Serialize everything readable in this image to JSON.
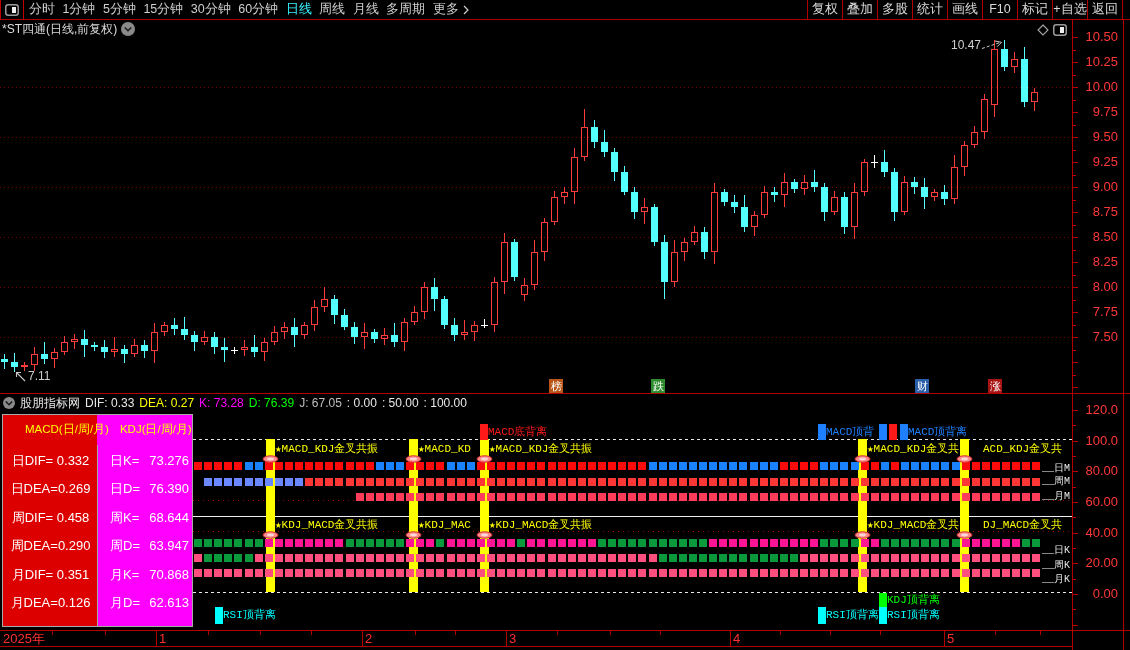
{
  "toolbar": {
    "periods": [
      {
        "label": "分时",
        "selected": false
      },
      {
        "label": "1分钟",
        "selected": false
      },
      {
        "label": "5分钟",
        "selected": false
      },
      {
        "label": "15分钟",
        "selected": false
      },
      {
        "label": "30分钟",
        "selected": false
      },
      {
        "label": "60分钟",
        "selected": false
      },
      {
        "label": "日线",
        "selected": true
      },
      {
        "label": "周线",
        "selected": false
      },
      {
        "label": "月线",
        "selected": false
      },
      {
        "label": "多周期",
        "selected": false
      }
    ],
    "more_menu": {
      "label": "更多"
    },
    "actions": [
      "复权",
      "叠加",
      "多股",
      "统计",
      "画线",
      "F10",
      "标记",
      "+自选",
      "返回"
    ]
  },
  "price_chart": {
    "title": "*ST四通(日线,前复权)",
    "high_label": "10.47",
    "low_label": "7.11",
    "price_ticks": [
      "10.50",
      "10.25",
      "10.00",
      "9.75",
      "9.50",
      "9.25",
      "9.00",
      "8.75",
      "8.50",
      "8.25",
      "8.00",
      "7.75",
      "7.50"
    ],
    "event_tags": [
      {
        "text": "榜",
        "color": "#b8561a"
      },
      {
        "text": "跌",
        "color": "#2e8b2e"
      },
      {
        "text": "财",
        "color": "#2a5ea8"
      },
      {
        "text": "涨",
        "color": "#a81414"
      }
    ]
  },
  "indicator": {
    "name": "股朋指标网",
    "readouts": [
      {
        "text": "DIF: 0.33",
        "color": "#e8e8e8"
      },
      {
        "text": "DEA: 0.27",
        "color": "#ffff00"
      },
      {
        "text": "K: 73.28",
        "color": "#ff00ff"
      },
      {
        "text": "D: 76.39",
        "color": "#00ff00"
      },
      {
        "text": "J: 67.05",
        "color": "#bfbfbf"
      },
      {
        "text": ": 0.00",
        "color": "#e8e8e8"
      },
      {
        "text": ": 50.00",
        "color": "#e8e8e8"
      },
      {
        "text": ": 100.00",
        "color": "#e8e8e8"
      }
    ],
    "value_panel": {
      "macd_title": "MACD(日/周/月)",
      "kdj_title": "KDJ(日/周/月)",
      "macd_rows": [
        "日DIF= 0.332",
        "日DEA=0.269",
        "周DIF= 0.458",
        "周DEA=0.290",
        "月DIF= 0.351",
        "月DEA=0.126"
      ],
      "kdj_rows": [
        {
          "label": "日K=",
          "value": "73.276"
        },
        {
          "label": "日D=",
          "value": "76.390"
        },
        {
          "label": "周K=",
          "value": "68.644"
        },
        {
          "label": "周D=",
          "value": "63.947"
        },
        {
          "label": "月K=",
          "value": "70.868"
        },
        {
          "label": "月D=",
          "value": "62.613"
        }
      ]
    },
    "value_ticks": [
      "120.0",
      "100.0",
      "80.00",
      "60.00",
      "40.00",
      "20.00",
      "0.00"
    ],
    "top_divergences": [
      {
        "text": "MACD底背离",
        "color": "#ff1a1a"
      },
      {
        "text": "MACD顶背",
        "color": "#1e80ff"
      },
      {
        "color": "#1e80ff"
      },
      {
        "color": "#ff1a1a"
      },
      {
        "text": "MACD顶背离",
        "color": "#1e80ff"
      }
    ],
    "resonance_signals": [
      {
        "macd_kdj": "★MACD_KDJ金叉共振",
        "kdj_macd": "★KDJ_MACD金叉共振"
      },
      {
        "macd_kdj": "★MACD_KD",
        "kdj_macd": "★KDJ_MAC"
      },
      {
        "macd_kdj": "★MACD_KDJ金叉共振",
        "kdj_macd": "★KDJ_MACD金叉共振"
      },
      {
        "macd_kdj": "★MACD_KDJ金叉共",
        "kdj_macd": "★KDJ_MACD金叉共"
      },
      {
        "macd_kdj": "ACD_KDJ金叉共",
        "kdj_macd": "DJ_MACD金叉共"
      }
    ],
    "row_labels": [
      "__日M",
      "__周M",
      "__月M",
      "__日K",
      "__周K",
      "__月K"
    ],
    "bottom_divergences": [
      {
        "text": "KDJ顶背离",
        "color": "#00ff00"
      },
      {
        "text": "RSI顶背离",
        "color": "#00ffff"
      },
      {
        "text": "RSI顶背离",
        "color": "#00ffff"
      },
      {
        "text": "RSI顶背离",
        "color": "#00ffff"
      }
    ]
  },
  "date_axis": {
    "labels": [
      "2025年",
      "1",
      "2",
      "3",
      "4",
      "5"
    ]
  }
}
